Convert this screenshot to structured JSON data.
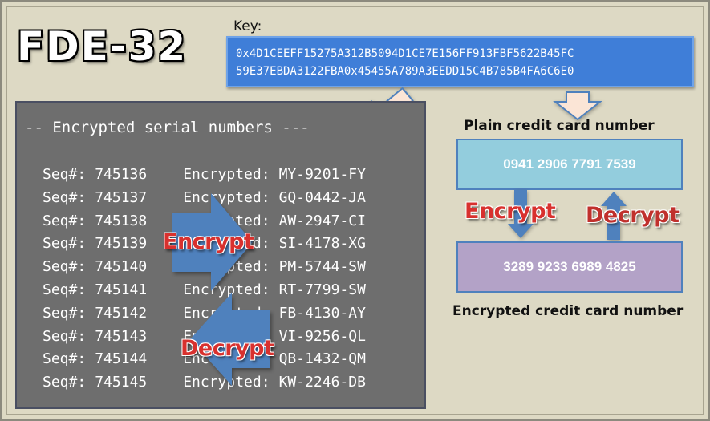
{
  "logo": {
    "text": "FDE-32"
  },
  "key": {
    "label": "Key:",
    "lines": [
      "0x4D1CEEFF15275A312B5094D1CE7E156FF913FBF5622B45FC",
      "59E37EBDA3122FBA0x45455A789A3EEDD15C4B785B4FA6C6E0"
    ]
  },
  "serial_panel": {
    "title": "-- Encrypted serial numbers ---",
    "seq_label": "Seq#:",
    "enc_label": "Encrypted:",
    "rows": [
      {
        "seq": "745136",
        "enc": "MY-9201-FY"
      },
      {
        "seq": "745137",
        "enc": "GQ-0442-JA"
      },
      {
        "seq": "745138",
        "enc": "AW-2947-CI"
      },
      {
        "seq": "745139",
        "enc": "SI-4178-XG"
      },
      {
        "seq": "745140",
        "enc": "PM-5744-SW"
      },
      {
        "seq": "745141",
        "enc": "RT-7799-SW"
      },
      {
        "seq": "745142",
        "enc": "FB-4130-AY"
      },
      {
        "seq": "745143",
        "enc": "VI-9256-QL"
      },
      {
        "seq": "745144",
        "enc": "QB-1432-QM"
      },
      {
        "seq": "745145",
        "enc": "KW-2246-DB"
      }
    ]
  },
  "labels": {
    "encrypt": "Encrypt",
    "decrypt": "Decrypt"
  },
  "card": {
    "plain_caption": "Plain credit card number",
    "plain_value": "0941 2906 7791 7539",
    "encrypted_caption": "Encrypted credit card number",
    "encrypted_value": "3289 9233 6989 4825"
  },
  "colors": {
    "background": "#ddd9c4",
    "key_box": "#3f7ed8",
    "serial_panel": "#6e6e6e",
    "arrow_blue": "#4f81bd",
    "encrypt_label": "#d8312e",
    "decrypt_label": "#c0302c",
    "plain_box": "#93cddd",
    "encrypted_box": "#b3a2c7",
    "key_arrow_fill": "#fbe5d6"
  }
}
